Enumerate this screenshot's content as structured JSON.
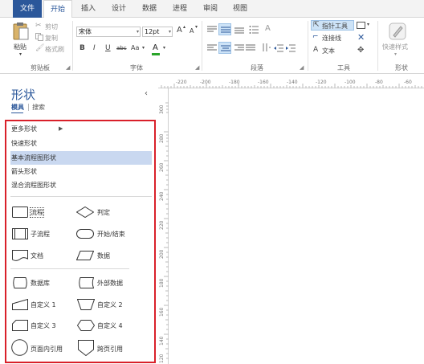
{
  "tabs": [
    {
      "label": "文件"
    },
    {
      "label": "开始"
    },
    {
      "label": "插入"
    },
    {
      "label": "设计"
    },
    {
      "label": "数据"
    },
    {
      "label": "进程"
    },
    {
      "label": "审阅"
    },
    {
      "label": "视图"
    }
  ],
  "active_tab": "开始",
  "ribbon": {
    "clipboard": {
      "paste": "粘贴",
      "cut": "剪切",
      "copy": "复制",
      "format_painter": "格式刷",
      "group": "剪贴板"
    },
    "font": {
      "family": "宋体",
      "size": "12pt",
      "grow": "A",
      "shrink": "A",
      "bold": "B",
      "italic": "I",
      "underline": "U",
      "strike": "abc",
      "case": "Aa",
      "color_a": "A",
      "group": "字体"
    },
    "paragraph": {
      "group": "段落"
    },
    "tools": {
      "pointer": "指针工具",
      "connector": "连接线",
      "text": "文本",
      "group": "工具"
    },
    "styles": {
      "quick_styles": "快速样式",
      "group": "形状"
    },
    "accent_color": "#2b579a"
  },
  "shapes_pane": {
    "title": "形状",
    "tab_stencils": "模具",
    "tab_search": "搜索",
    "stencil_list": [
      {
        "label": "更多形状"
      },
      {
        "label": "快速形状"
      },
      {
        "label": "基本流程图形状",
        "selected": true
      },
      {
        "label": "箭头形状"
      },
      {
        "label": "混合流程图形状"
      }
    ],
    "shapes": [
      {
        "label": "流程",
        "icon": "process-shape-icon"
      },
      {
        "label": "判定",
        "icon": "decision-shape-icon"
      },
      {
        "label": "子流程",
        "icon": "subprocess-shape-icon"
      },
      {
        "label": "开始/结束",
        "icon": "terminator-shape-icon"
      },
      {
        "label": "文档",
        "icon": "document-shape-icon"
      },
      {
        "label": "数据",
        "icon": "data-shape-icon"
      },
      {
        "label": "数据库",
        "icon": "database-shape-icon"
      },
      {
        "label": "外部数据",
        "icon": "external-data-shape-icon"
      },
      {
        "label": "自定义 1",
        "icon": "custom1-shape-icon"
      },
      {
        "label": "自定义 2",
        "icon": "custom2-shape-icon"
      },
      {
        "label": "自定义 3",
        "icon": "custom3-shape-icon"
      },
      {
        "label": "自定义 4",
        "icon": "custom4-shape-icon"
      },
      {
        "label": "页面内引用",
        "icon": "on-page-reference-shape-icon"
      },
      {
        "label": "跨页引用",
        "icon": "off-page-reference-shape-icon"
      }
    ]
  },
  "ruler": {
    "h_labels": [
      "-220",
      "-200",
      "-180",
      "-160",
      "-140",
      "-120",
      "-100",
      "-80",
      "-60"
    ],
    "v_labels": [
      "300",
      "280",
      "260",
      "240",
      "220",
      "200",
      "180",
      "160",
      "140",
      "120"
    ]
  }
}
